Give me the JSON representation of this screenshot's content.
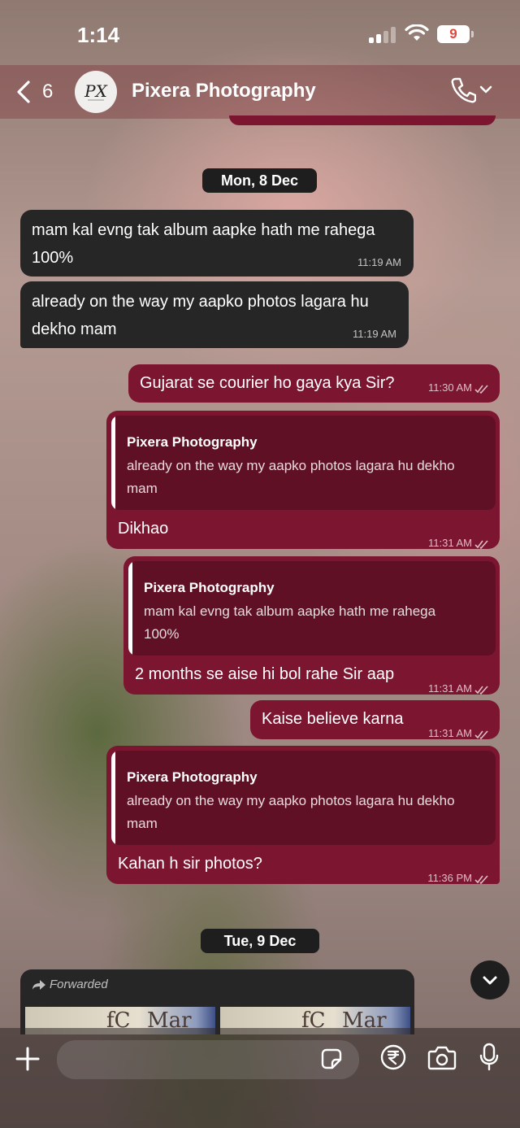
{
  "status_bar": {
    "time": "1:14",
    "battery": "9"
  },
  "header": {
    "back_count": "6",
    "contact_name": "Pixera Photography"
  },
  "dates": {
    "d1": "Mon, 8 Dec",
    "d2": "Tue, 9 Dec"
  },
  "messages": [
    {
      "dir": "in",
      "text": "mam kal evng tak album aapke hath me rahega\n100%",
      "time": "11:19 AM"
    },
    {
      "dir": "in",
      "text": "already on the way my aapko photos lagara hu\ndekho mam",
      "time": "11:19 AM"
    },
    {
      "dir": "out",
      "text": "Gujarat se courier ho gaya kya Sir?",
      "time": "11:30 AM"
    },
    {
      "dir": "out",
      "quote_name": "Pixera Photography",
      "quote_text": "already on the way my aapko photos lagara hu dekho\nmam",
      "text": "Dikhao",
      "time": "11:31 AM"
    },
    {
      "dir": "out",
      "quote_name": "Pixera Photography",
      "quote_text": "mam kal evng tak album aapke hath me rahega\n100%",
      "text": "2 months se aise hi bol rahe Sir aap",
      "time": "11:31 AM"
    },
    {
      "dir": "out",
      "text": "Kaise believe karna",
      "time": "11:31 AM"
    },
    {
      "dir": "out",
      "quote_name": "Pixera Photography",
      "quote_text": "already on the way my aapko photos lagara hu dekho\nmam",
      "text": "Kahan h sir photos?",
      "time": "11:36 PM"
    }
  ],
  "forwarded": {
    "label": "Forwarded"
  },
  "composer": {
    "placeholder": ""
  },
  "icons": {
    "back": "chevron-left-icon",
    "call": "phone-icon",
    "scroll": "chevron-down-icon",
    "attach": "plus-icon",
    "sticker": "sticker-icon",
    "payment": "rupee-icon",
    "camera": "camera-icon",
    "mic": "microphone-icon"
  },
  "colors": {
    "outgoing_bubble": "#7c1530",
    "incoming_bubble": "#262626",
    "quote_bg": "#5f1025",
    "date_pill": "#1e1e1e"
  }
}
